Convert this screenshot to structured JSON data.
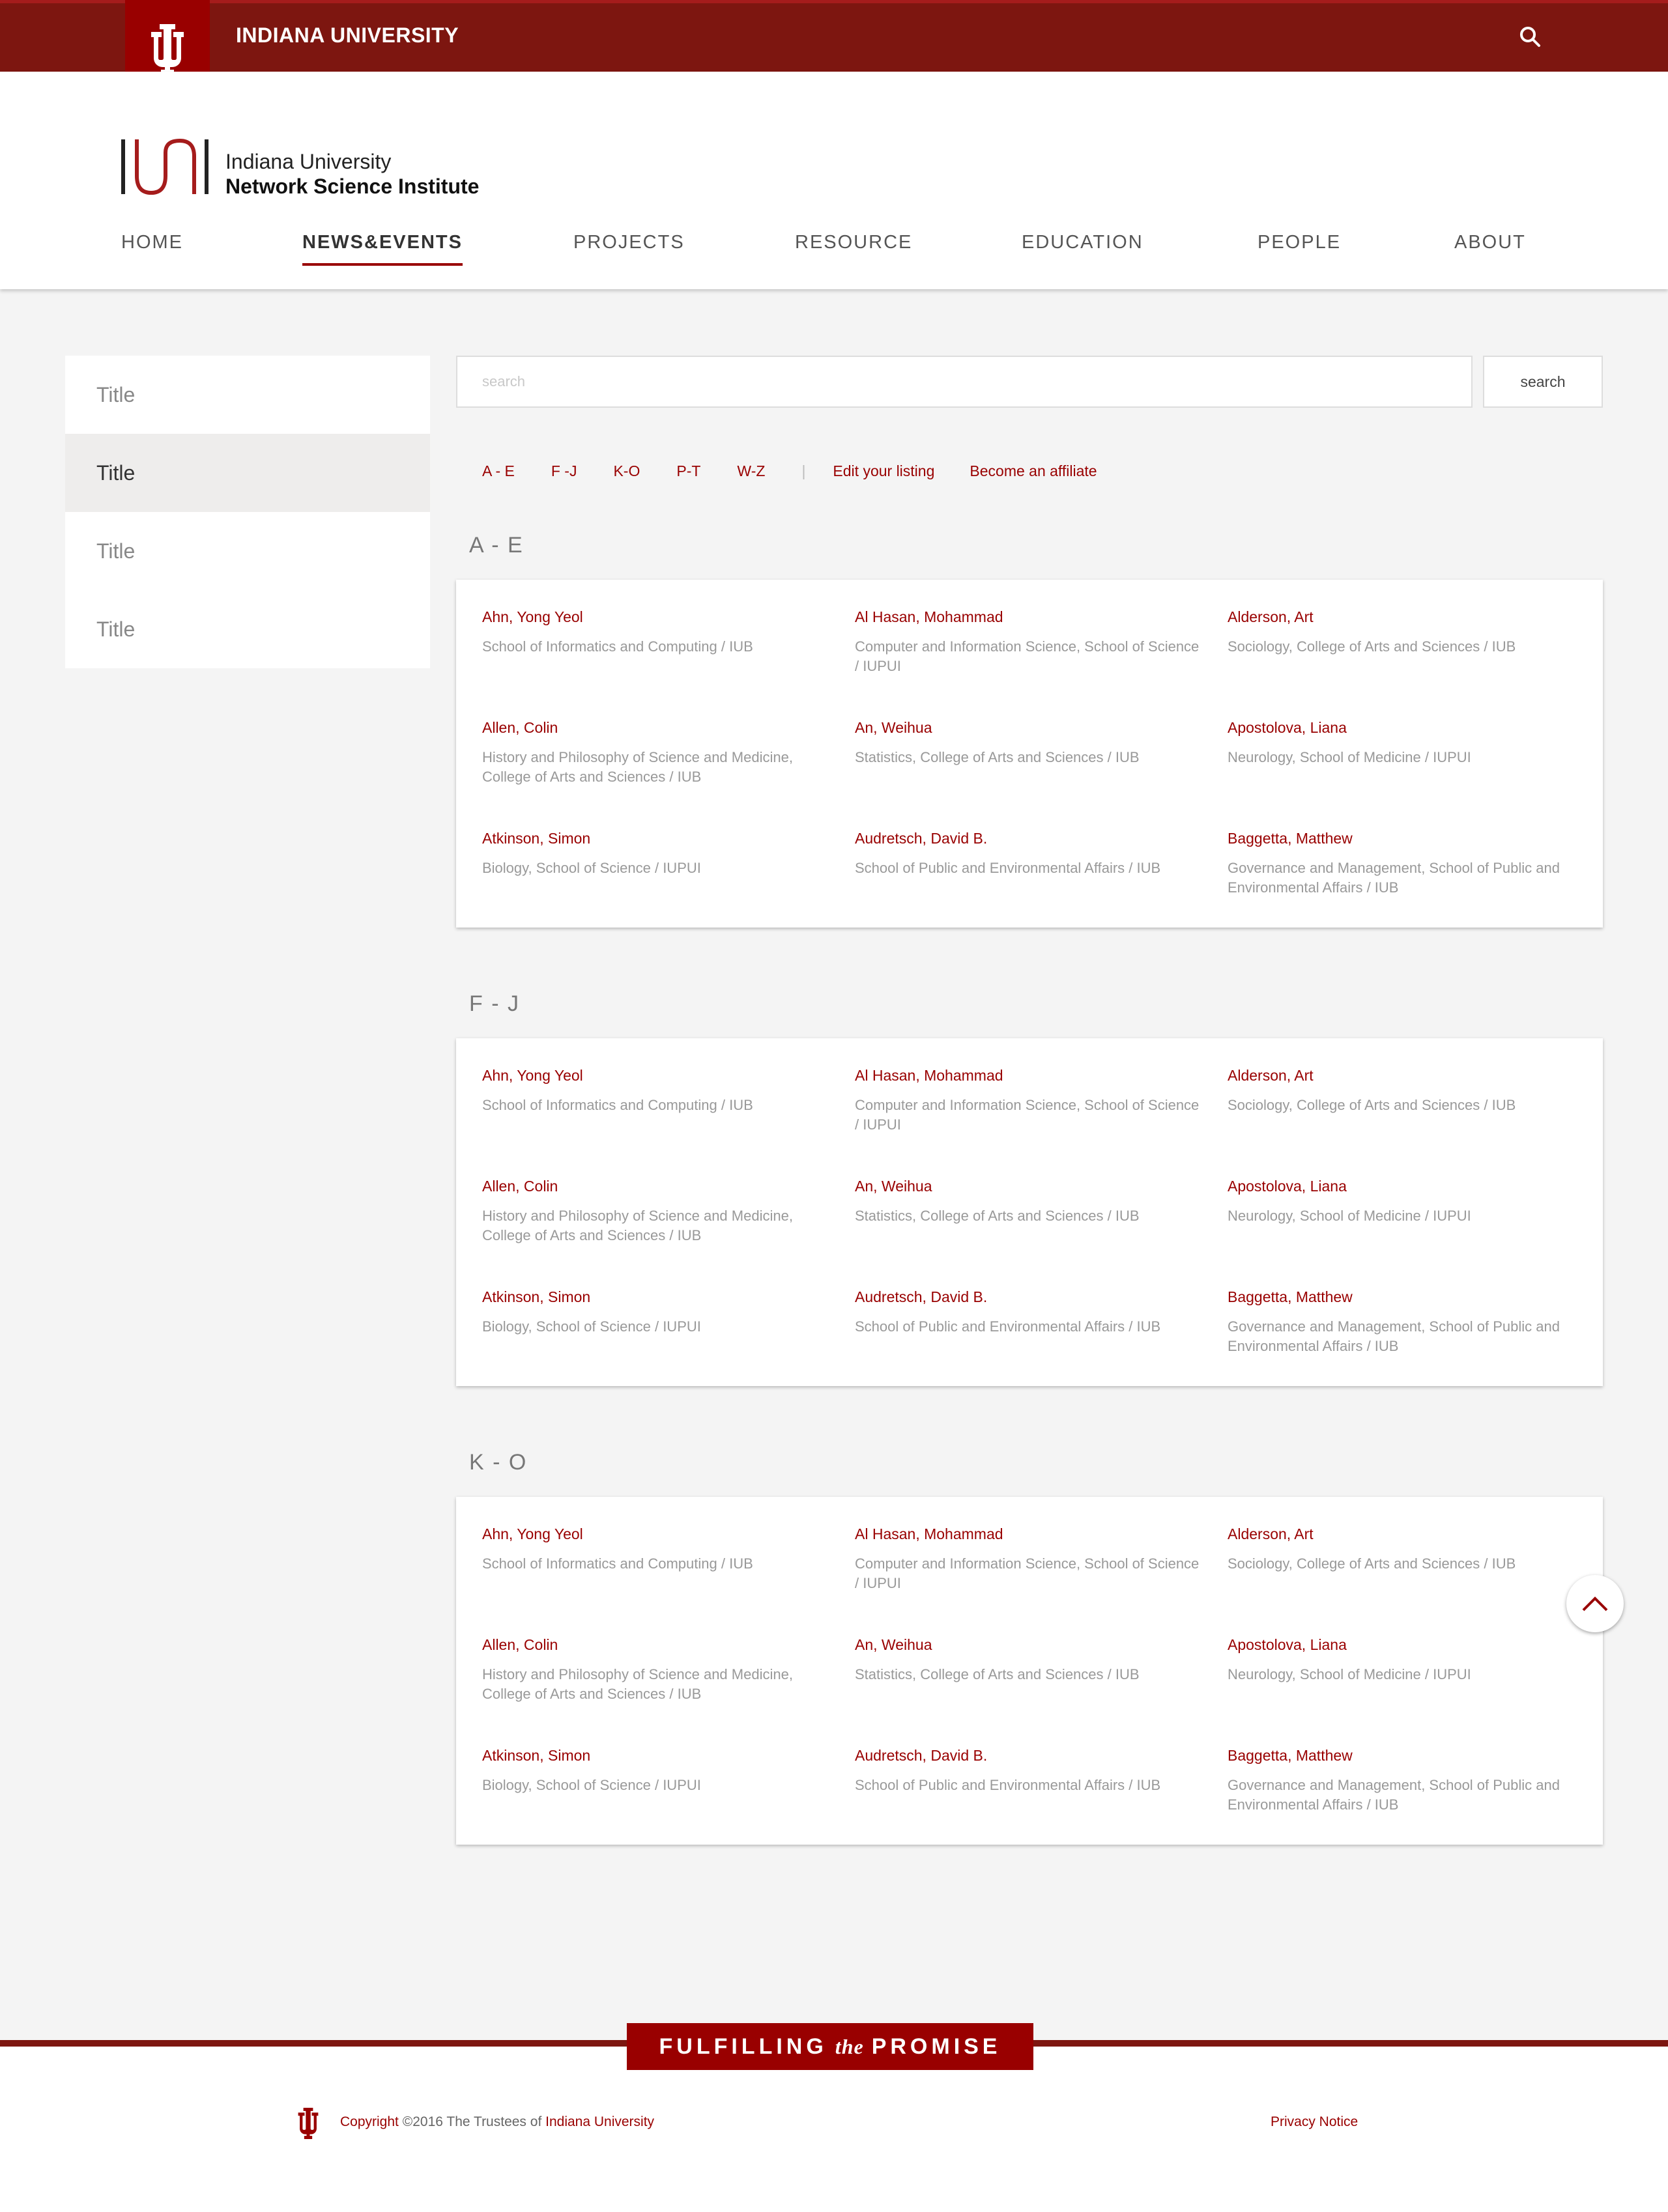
{
  "topbar": {
    "university": "INDIANA UNIVERSITY",
    "search_icon": "search-icon"
  },
  "header": {
    "logo_line1": "Indiana University",
    "logo_line2": "Network Science Institute",
    "nav": [
      "HOME",
      "NEWS&EVENTS",
      "PROJECTS",
      "RESOURCE",
      "EDUCATION",
      "PEOPLE",
      "ABOUT"
    ],
    "active_nav": "NEWS&EVENTS"
  },
  "sidebar": {
    "items": [
      "Title",
      "Title",
      "Title",
      "Title"
    ],
    "active_index": 1
  },
  "search": {
    "placeholder": "search",
    "value": "",
    "button": "search"
  },
  "filters": {
    "ranges": [
      "A - E",
      "F -J",
      "K-O",
      "P-T",
      "W-Z"
    ],
    "separator": "|",
    "edit_listing": "Edit your listing",
    "affiliate": "Become an affiliate"
  },
  "sections": [
    {
      "title": "A - E",
      "entries": [
        {
          "name": "Ahn, Yong Yeol",
          "affiliation": "School of Informatics and Computing / IUB"
        },
        {
          "name": "Al Hasan, Mohammad",
          "affiliation": "Computer and Information Science, School of Science / IUPUI"
        },
        {
          "name": "Alderson, Art",
          "affiliation": "Sociology, College of Arts and Sciences / IUB"
        },
        {
          "name": "Allen, Colin",
          "affiliation": "History and Philosophy of Science and Medicine, College of Arts and Sciences / IUB"
        },
        {
          "name": "An, Weihua",
          "affiliation": "Statistics, College of Arts and Sciences / IUB"
        },
        {
          "name": "Apostolova, Liana",
          "affiliation": "Neurology, School of Medicine / IUPUI"
        },
        {
          "name": "Atkinson, Simon",
          "affiliation": "Biology, School of Science / IUPUI"
        },
        {
          "name": "Audretsch, David B.",
          "affiliation": "School of Public and Environmental Affairs / IUB"
        },
        {
          "name": "Baggetta, Matthew",
          "affiliation": "Governance and Management, School of Public and Environmental Affairs / IUB"
        }
      ]
    },
    {
      "title": "F - J",
      "entries": [
        {
          "name": "Ahn, Yong Yeol",
          "affiliation": "School of Informatics and Computing / IUB"
        },
        {
          "name": "Al Hasan, Mohammad",
          "affiliation": "Computer and Information Science, School of Science / IUPUI"
        },
        {
          "name": "Alderson, Art",
          "affiliation": "Sociology, College of Arts and Sciences / IUB"
        },
        {
          "name": "Allen, Colin",
          "affiliation": "History and Philosophy of Science and Medicine, College of Arts and Sciences / IUB"
        },
        {
          "name": "An, Weihua",
          "affiliation": "Statistics, College of Arts and Sciences / IUB"
        },
        {
          "name": "Apostolova, Liana",
          "affiliation": "Neurology, School of Medicine / IUPUI"
        },
        {
          "name": "Atkinson, Simon",
          "affiliation": "Biology, School of Science / IUPUI"
        },
        {
          "name": "Audretsch, David B.",
          "affiliation": "School of Public and Environmental Affairs / IUB"
        },
        {
          "name": "Baggetta, Matthew",
          "affiliation": "Governance and Management, School of Public and Environmental Affairs / IUB"
        }
      ]
    },
    {
      "title": "K - O",
      "entries": [
        {
          "name": "Ahn, Yong Yeol",
          "affiliation": "School of Informatics and Computing / IUB"
        },
        {
          "name": "Al Hasan, Mohammad",
          "affiliation": "Computer and Information Science, School of Science / IUPUI"
        },
        {
          "name": "Alderson, Art",
          "affiliation": "Sociology, College of Arts and Sciences / IUB"
        },
        {
          "name": "Allen, Colin",
          "affiliation": "History and Philosophy of Science and Medicine, College of Arts and Sciences / IUB"
        },
        {
          "name": "An, Weihua",
          "affiliation": "Statistics, College of Arts and Sciences / IUB"
        },
        {
          "name": "Apostolova, Liana",
          "affiliation": "Neurology, School of Medicine / IUPUI"
        },
        {
          "name": "Atkinson, Simon",
          "affiliation": "Biology, School of Science / IUPUI"
        },
        {
          "name": "Audretsch, David B.",
          "affiliation": "School of Public and Environmental Affairs / IUB"
        },
        {
          "name": "Baggetta, Matthew",
          "affiliation": "Governance and Management, School of Public and Environmental Affairs / IUB"
        }
      ]
    }
  ],
  "footer": {
    "promise_left": "FULFILLING",
    "promise_mid": "the",
    "promise_right": "PROMISE",
    "copyright_a": "Copyright",
    "copyright_b": "©2016 The Trustees of",
    "copyright_c": "Indiana University",
    "privacy": "Privacy Notice"
  },
  "colors": {
    "crimson": "#990000",
    "dark_crimson": "#7d1610",
    "background": "#f4f4f4"
  }
}
